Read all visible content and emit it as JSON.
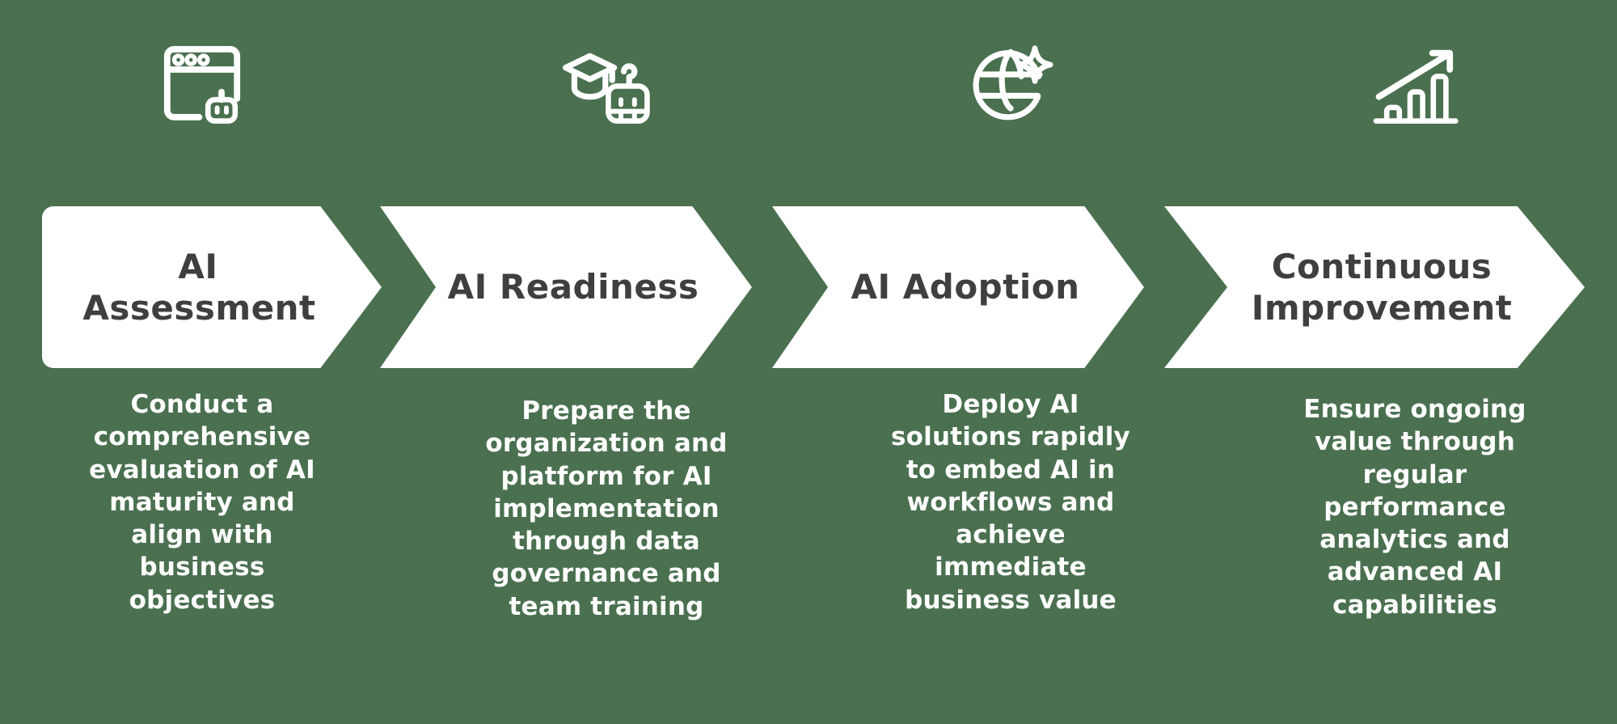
{
  "theme": {
    "background_color": "#4a7050",
    "chevron_fill": "#ffffff",
    "heading_color": "#3f3f3f",
    "description_color": "#ffffff",
    "icon_color": "#ffffff"
  },
  "steps": [
    {
      "icon": "browser-window-robot-icon",
      "title": "AI\nAssessment",
      "description": "Conduct a comprehensive evaluation of AI maturity and align with business objectives"
    },
    {
      "icon": "graduation-cap-robot-icon",
      "title": "AI Readiness",
      "description": "Prepare the organization and platform for AI implementation through data governance and team training"
    },
    {
      "icon": "globe-sparkle-icon",
      "title": "AI Adoption",
      "description": "Deploy AI solutions rapidly to embed AI in workflows and achieve immediate business value"
    },
    {
      "icon": "growth-bar-chart-arrow-icon",
      "title": "Continuous\nImprovement",
      "description": "Ensure ongoing value through regular performance analytics and advanced AI capabilities"
    }
  ]
}
